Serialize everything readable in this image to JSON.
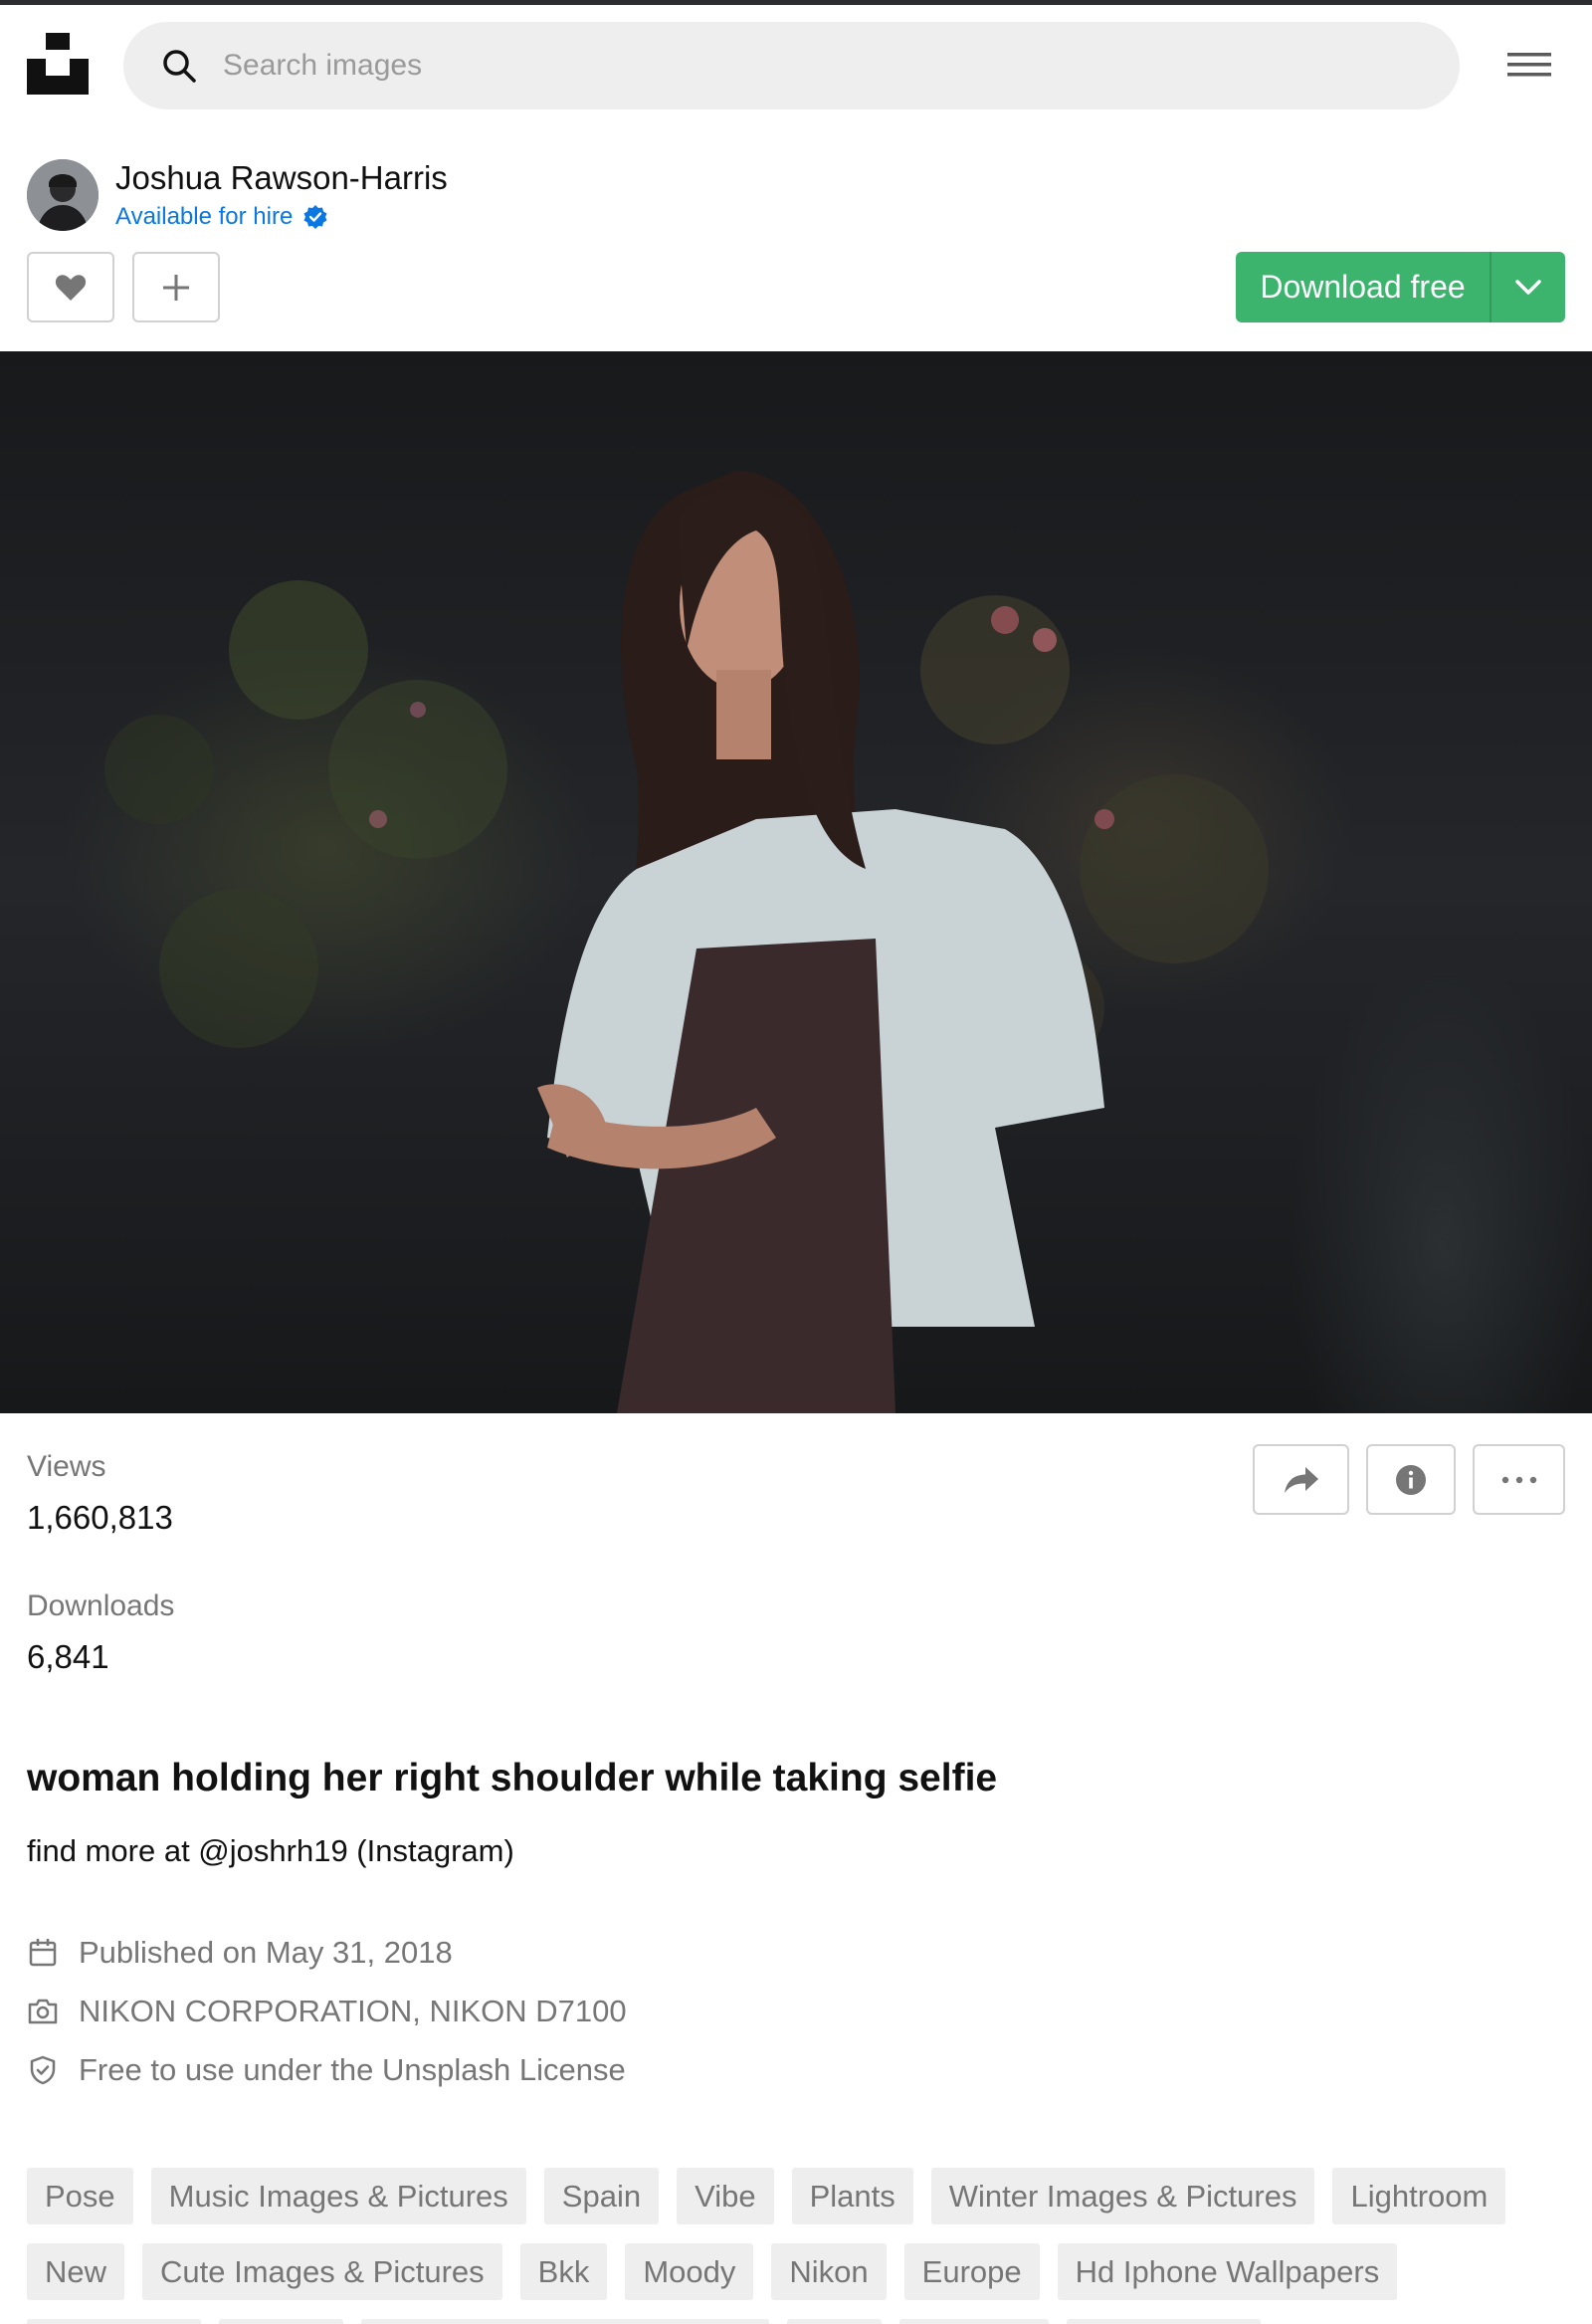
{
  "search": {
    "placeholder": "Search images"
  },
  "author": {
    "name": "Joshua Rawson-Harris",
    "availability": "Available for hire"
  },
  "actions": {
    "download_label": "Download free"
  },
  "stats": {
    "views_label": "Views",
    "views_value": "1,660,813",
    "downloads_label": "Downloads",
    "downloads_value": "6,841"
  },
  "photo_info": {
    "title": "woman holding her right shoulder while taking selfie",
    "description": "find more at @joshrh19 (Instagram)",
    "published": "Published on May 31, 2018",
    "camera": "NIKON CORPORATION, NIKON D7100",
    "license": "Free to use under the Unsplash License"
  },
  "tags": {
    "row1": [
      "Pose",
      "Music Images & Pictures",
      "Spain",
      "Vibe",
      "Plants",
      "Winter Images & Pictures",
      "Lightroom"
    ],
    "row2": [
      "New",
      "Cute Images & Pictures",
      "Bkk",
      "Moody",
      "Nikon",
      "Europe",
      "Hd Iphone Wallpapers"
    ]
  },
  "colors": {
    "accent_green": "#3cb46e",
    "link_blue": "#0b77e3",
    "muted_text": "#767676"
  },
  "icons": [
    "unsplash-logo",
    "search-icon",
    "menu-icon",
    "verified-icon",
    "heart-icon",
    "plus-icon",
    "chevron-down-icon",
    "share-icon",
    "info-icon",
    "more-icon",
    "calendar-icon",
    "camera-icon",
    "shield-check-icon"
  ]
}
